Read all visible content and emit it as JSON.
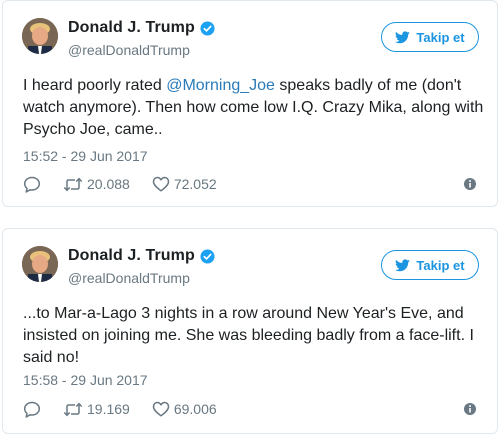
{
  "colors": {
    "accent": "#1b95e0",
    "mention": "#2b7bb9",
    "text": "#1c2022",
    "muted": "#697882",
    "border": "#e1e8ed"
  },
  "tweets": [
    {
      "display_name": "Donald J. Trump",
      "handle": "@realDonaldTrump",
      "follow_label": "Takip et",
      "text_before": "I heard poorly rated ",
      "mention": "@Morning_Joe",
      "text_after": " speaks badly of me (don't watch anymore). Then how come low I.Q. Crazy Mika, along with Psycho Joe, came..",
      "timestamp": "15:52 - 29 Jun 2017",
      "retweets": "20.088",
      "likes": "72.052"
    },
    {
      "display_name": "Donald J. Trump",
      "handle": "@realDonaldTrump",
      "follow_label": "Takip et",
      "text_before": "...to Mar-a-Lago 3 nights in a row around New Year's Eve, and insisted on joining me. She was bleeding badly from a face-lift. I said no!",
      "mention": "",
      "text_after": "",
      "timestamp": "15:58 - 29 Jun 2017",
      "retweets": "19.169",
      "likes": "69.006"
    }
  ]
}
